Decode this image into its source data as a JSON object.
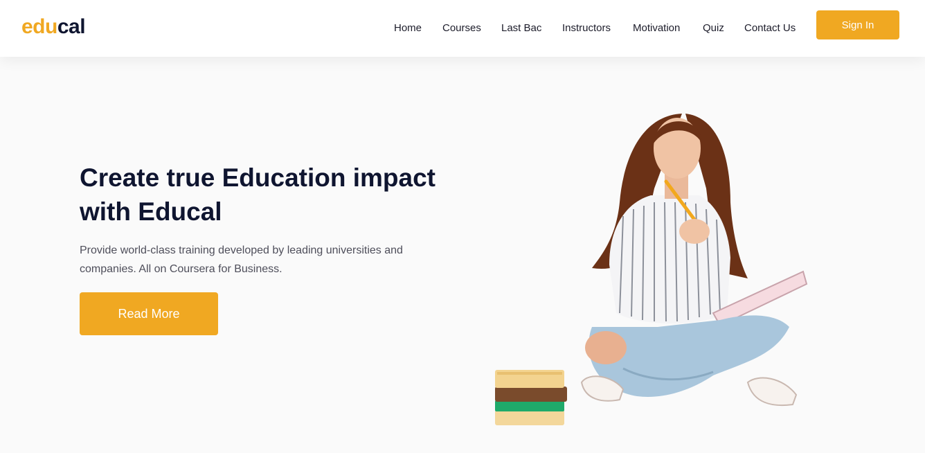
{
  "logo": {
    "part1": "edu",
    "part2": "cal"
  },
  "nav": {
    "items": [
      "Home",
      "Courses",
      "Last Bac",
      "Instructors",
      "Motivation",
      "Quiz",
      "Contact Us"
    ]
  },
  "header": {
    "signin_label": "Sign In"
  },
  "hero": {
    "headline_line1": "Create true Education impact",
    "headline_line2": "with Educal",
    "sub_line1": "Provide world-class training developed by leading universities and",
    "sub_line2": "companies. All on Coursera for Business.",
    "cta_label": "Read More"
  },
  "colors": {
    "accent": "#f0a822",
    "heading": "#0f1530",
    "background": "#fafafa"
  }
}
